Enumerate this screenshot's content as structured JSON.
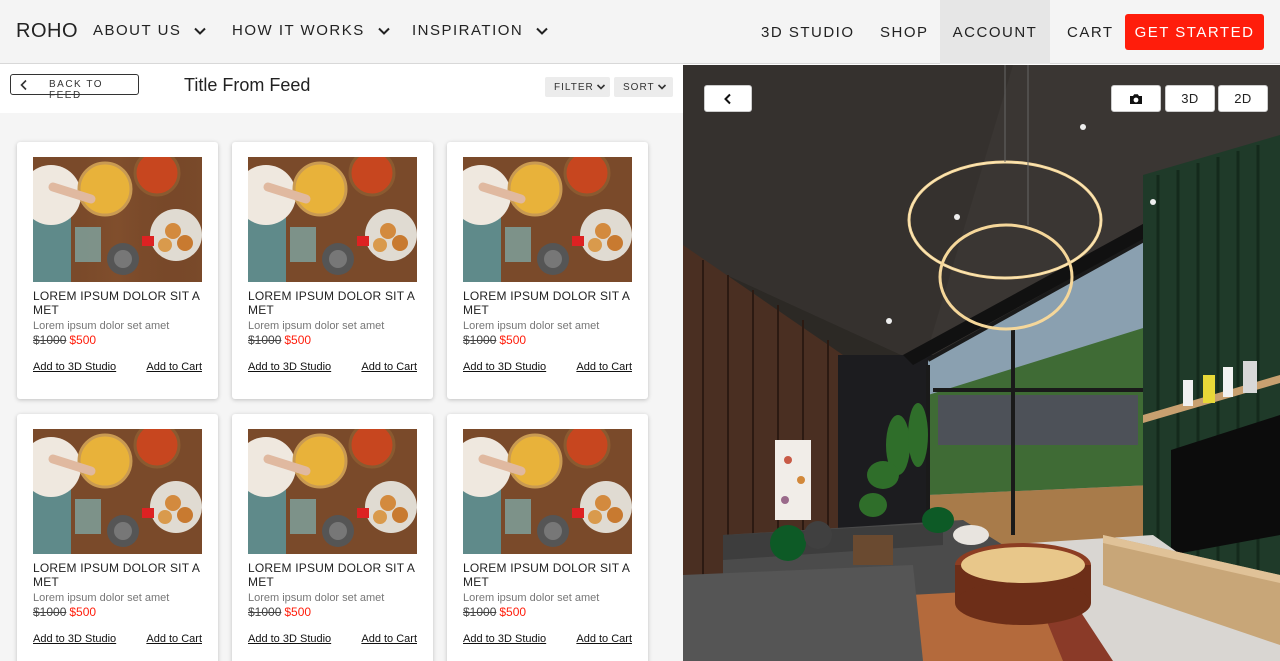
{
  "nav": {
    "logo": "ROHO",
    "items": [
      {
        "label": "ABOUT US"
      },
      {
        "label": "HOW IT WORKS"
      },
      {
        "label": "INSPIRATION"
      }
    ],
    "studio": "3D STUDIO",
    "shop": "SHOP",
    "account": "ACCOUNT",
    "cart": "CART",
    "cta": "GET STARTED"
  },
  "feed": {
    "back_label": "BACK TO FEED",
    "title": "Title From Feed",
    "filter_label": "FILTER",
    "sort_label": "SORT"
  },
  "products": [
    {
      "title": "LOREM IPSUM DOLOR SIT A MET",
      "subtitle": "Lorem ipsum dolor set amet",
      "old_price": "$1000",
      "price": "$500",
      "add_3d": "Add to 3D Studio",
      "add_cart": "Add to Cart"
    },
    {
      "title": "LOREM IPSUM DOLOR SIT A MET",
      "subtitle": "Lorem ipsum dolor set amet",
      "old_price": "$1000",
      "price": "$500",
      "add_3d": "Add to 3D Studio",
      "add_cart": "Add to Cart"
    },
    {
      "title": "LOREM IPSUM DOLOR SIT A MET",
      "subtitle": "Lorem ipsum dolor set amet",
      "old_price": "$1000",
      "price": "$500",
      "add_3d": "Add to 3D Studio",
      "add_cart": "Add to Cart"
    },
    {
      "title": "LOREM IPSUM DOLOR SIT A MET",
      "subtitle": "Lorem ipsum dolor set amet",
      "old_price": "$1000",
      "price": "$500",
      "add_3d": "Add to 3D Studio",
      "add_cart": "Add to Cart"
    },
    {
      "title": "LOREM IPSUM DOLOR SIT A MET",
      "subtitle": "Lorem ipsum dolor set amet",
      "old_price": "$1000",
      "price": "$500",
      "add_3d": "Add to 3D Studio",
      "add_cart": "Add to Cart"
    },
    {
      "title": "LOREM IPSUM DOLOR SIT A MET",
      "subtitle": "Lorem ipsum dolor set amet",
      "old_price": "$1000",
      "price": "$500",
      "add_3d": "Add to 3D Studio",
      "add_cart": "Add to Cart"
    }
  ],
  "viewer": {
    "back_icon": "chevron-left-icon",
    "camera_icon": "camera-icon",
    "mode_3d": "3D",
    "mode_2d": "2D"
  },
  "colors": {
    "accent": "#ff1d0b",
    "nav_bg": "#f4f4f4",
    "account_active_bg": "#e6e6e6"
  }
}
